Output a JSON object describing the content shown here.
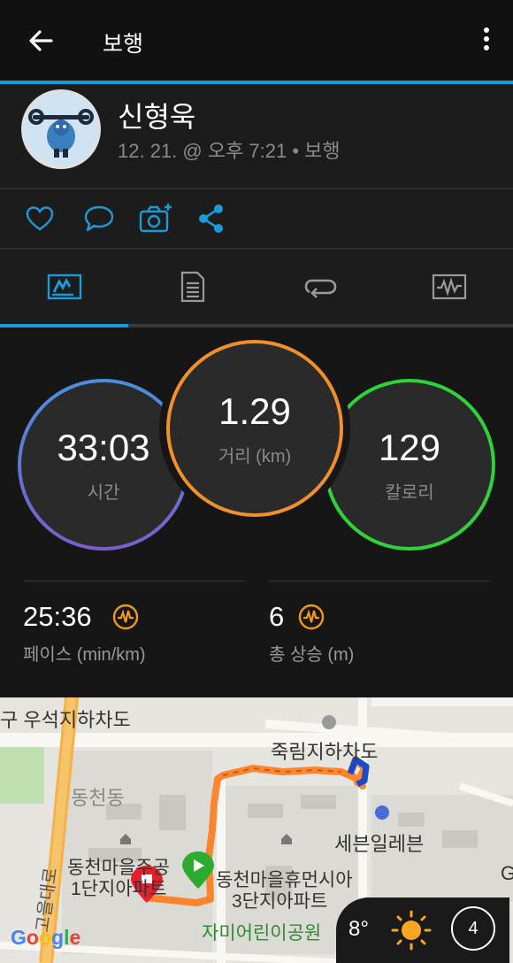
{
  "header": {
    "title": "보행"
  },
  "activity": {
    "user_name": "신형욱",
    "meta": "12. 21. @ 오후 7:21 • 보행"
  },
  "actions": {
    "icons": [
      "heart-icon",
      "comment-icon",
      "camera-add-icon",
      "share-icon"
    ]
  },
  "tabs": [
    {
      "icon": "summary-icon",
      "active": true
    },
    {
      "icon": "details-icon",
      "active": false
    },
    {
      "icon": "laps-icon",
      "active": false
    },
    {
      "icon": "chart-icon",
      "active": false
    }
  ],
  "stats": {
    "time": {
      "value": "33:03",
      "label": "시간"
    },
    "distance": {
      "value": "1.29",
      "label": "거리 (km)"
    },
    "calories": {
      "value": "129",
      "label": "칼로리"
    },
    "pace": {
      "value": "25:36",
      "label": "페이스 (min/km)"
    },
    "ascent": {
      "value": "6",
      "label": "총 상승 (m)"
    }
  },
  "colors": {
    "accent": "#1a9ad6",
    "time_ring_start": "#4a8fe0",
    "time_ring_end": "#7a5ec8",
    "distance_ring": "#f0902c",
    "calories_ring": "#2fd23a",
    "metric_icon": "#f29a1a"
  },
  "map": {
    "labels": {
      "top_left": "구  우석지하차도",
      "jukrim": "죽림지하차도",
      "dongcheon": "동천동",
      "seven_eleven": "세븐일레븐",
      "apt1_line1": "동천마을주공",
      "apt1_line2": "1단지아파트",
      "apt2_line1": "동천마을휴먼시아",
      "apt2_line2": "3단지아파트",
      "park": "자미어린이공원",
      "road": "고을대로",
      "edge_g": "G"
    },
    "google": "Google",
    "weather": {
      "temp": "8°",
      "icon": "sun-icon",
      "wind": "4"
    }
  }
}
